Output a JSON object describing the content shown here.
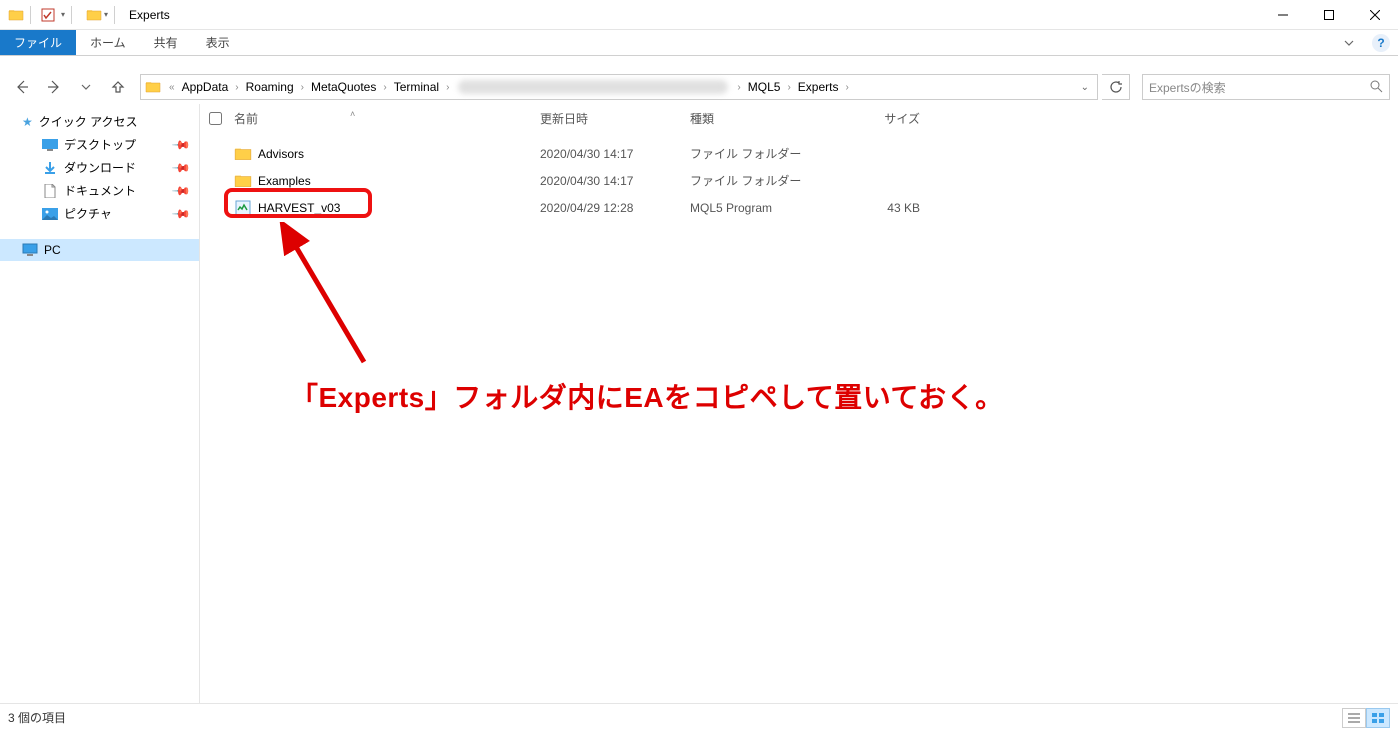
{
  "window": {
    "title": "Experts"
  },
  "ribbon": {
    "file": "ファイル",
    "tabs": [
      "ホーム",
      "共有",
      "表示"
    ]
  },
  "nav_arrows": {
    "back": "←",
    "forward": "→",
    "up": "↑"
  },
  "breadcrumb": {
    "segments": [
      "AppData",
      "Roaming",
      "MetaQuotes",
      "Terminal",
      "",
      "MQL5",
      "Experts"
    ],
    "overflow": "«"
  },
  "search": {
    "placeholder": "Expertsの検索"
  },
  "sidebar": {
    "quick_access": "クイック アクセス",
    "items": [
      {
        "label": "デスクトップ",
        "icon": "desktop"
      },
      {
        "label": "ダウンロード",
        "icon": "download"
      },
      {
        "label": "ドキュメント",
        "icon": "document"
      },
      {
        "label": "ピクチャ",
        "icon": "pictures"
      }
    ],
    "pc": "PC"
  },
  "columns": {
    "name": "名前",
    "date": "更新日時",
    "type": "種類",
    "size": "サイズ"
  },
  "rows": [
    {
      "name": "Advisors",
      "date": "2020/04/30 14:17",
      "type": "ファイル フォルダー",
      "size": "",
      "icon": "folder"
    },
    {
      "name": "Examples",
      "date": "2020/04/30 14:17",
      "type": "ファイル フォルダー",
      "size": "",
      "icon": "folder"
    },
    {
      "name": "HARVEST_v03",
      "date": "2020/04/29 12:28",
      "type": "MQL5 Program",
      "size": "43 KB",
      "icon": "mql5"
    }
  ],
  "status": {
    "items": "3 個の項目"
  },
  "annotation": {
    "text": "「Experts」フォルダ内にEAをコピペして置いておく。"
  }
}
